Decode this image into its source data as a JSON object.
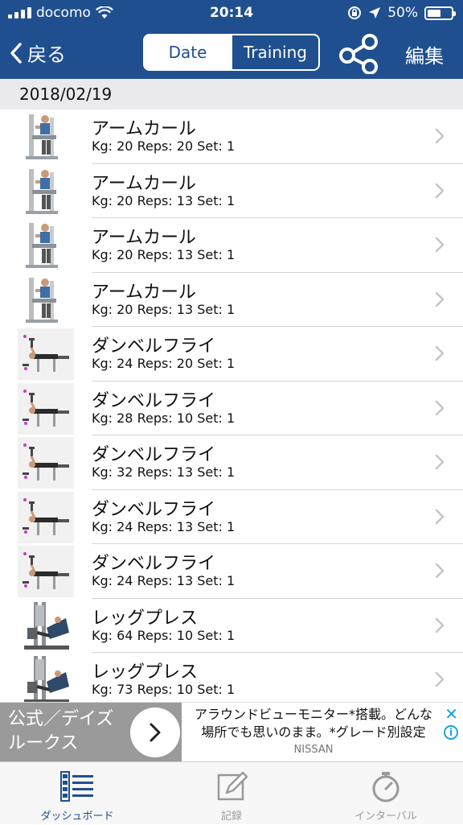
{
  "status_bar": {
    "carrier": "docomo",
    "time": "20:14",
    "battery": "50%"
  },
  "nav": {
    "back_label": "戻る",
    "segments": [
      "Date",
      "Training"
    ],
    "edit_label": "編集"
  },
  "section": {
    "date": "2018/02/19"
  },
  "workouts": [
    {
      "name": "アームカール",
      "detail": "Kg: 20 Reps: 20 Set: 1",
      "icon": "arm-curl-machine"
    },
    {
      "name": "アームカール",
      "detail": "Kg: 20 Reps: 13 Set: 1",
      "icon": "arm-curl-machine"
    },
    {
      "name": "アームカール",
      "detail": "Kg: 20 Reps: 13 Set: 1",
      "icon": "arm-curl-machine"
    },
    {
      "name": "アームカール",
      "detail": "Kg: 20 Reps: 13 Set: 1",
      "icon": "arm-curl-machine"
    },
    {
      "name": "ダンベルフライ",
      "detail": "Kg: 24 Reps: 20 Set: 1",
      "icon": "dumbbell-fly-bench"
    },
    {
      "name": "ダンベルフライ",
      "detail": "Kg: 28 Reps: 10 Set: 1",
      "icon": "dumbbell-fly-bench"
    },
    {
      "name": "ダンベルフライ",
      "detail": "Kg: 32 Reps: 13 Set: 1",
      "icon": "dumbbell-fly-bench"
    },
    {
      "name": "ダンベルフライ",
      "detail": "Kg: 24 Reps: 13 Set: 1",
      "icon": "dumbbell-fly-bench"
    },
    {
      "name": "ダンベルフライ",
      "detail": "Kg: 24 Reps: 13 Set: 1",
      "icon": "dumbbell-fly-bench"
    },
    {
      "name": "レッグプレス",
      "detail": "Kg: 64 Reps: 10 Set: 1",
      "icon": "leg-press-machine"
    },
    {
      "name": "レッグプレス",
      "detail": "Kg: 73 Reps: 10 Set: 1",
      "icon": "leg-press-machine"
    }
  ],
  "ad": {
    "left_line1": "公式／デイズ",
    "left_line2": "ルークス",
    "text_line1": "アラウンドビューモニター*搭載。どんな",
    "text_line2": "場所でも思いのまま。*グレード別設定",
    "sponsor": "NISSAN"
  },
  "tabs": [
    {
      "label": "ダッシュボード",
      "icon": "dashboard-icon",
      "active": true
    },
    {
      "label": "記録",
      "icon": "pencil-note-icon",
      "active": false
    },
    {
      "label": "インターバル",
      "icon": "stopwatch-icon",
      "active": false
    }
  ],
  "colors": {
    "nav_bg": "#1f4f8f",
    "section_bg": "#e9e9ee",
    "tab_active": "#1f4f8f",
    "tab_inactive": "#999999"
  }
}
